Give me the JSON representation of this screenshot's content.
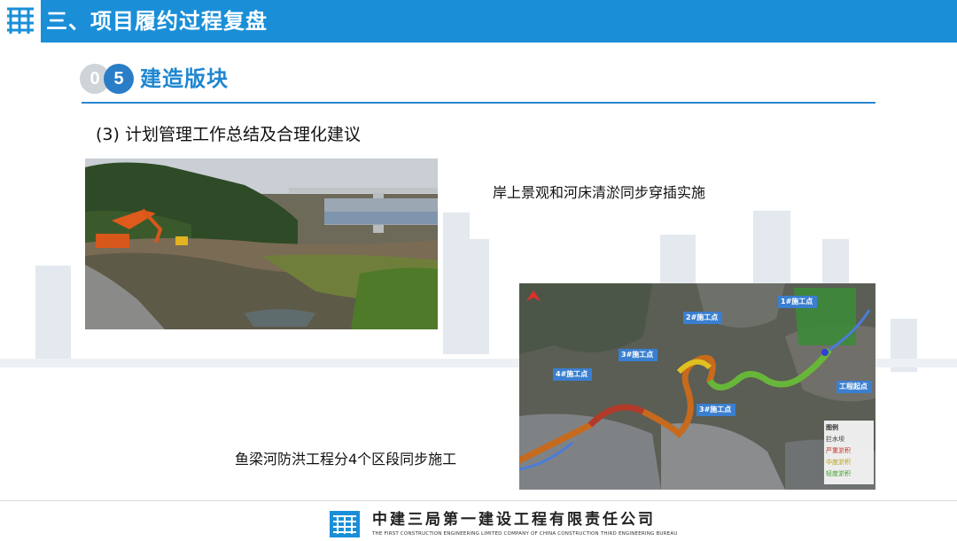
{
  "header": {
    "logo": "cscec-logo-icon",
    "title": "三、项目履约过程复盘",
    "color": "#1a8fd8"
  },
  "section": {
    "number_first": "0",
    "number_second": "5",
    "title": "建造版块",
    "accent": "#1f86d1"
  },
  "subtitle": "(3) 计划管理工作总结及合理化建议",
  "captions": {
    "photo": "岸上景观和河床清淤同步穿插实施",
    "map": "鱼梁河防洪工程分4个区段同步施工"
  },
  "map_labels": {
    "site1": "1#施工点",
    "site2": "2#施工点",
    "site3a": "3#施工点",
    "site3b": "3#施工点",
    "site4": "4#施工点",
    "start": "工程起点",
    "legend": [
      "图例",
      "拦水坝",
      "严重淤积",
      "中度淤积",
      "轻度淤积"
    ]
  },
  "footer": {
    "logo": "cscec-logo-icon",
    "company_cn": "中建三局第一建设工程有限责任公司",
    "company_en": "THE FIRST CONSTRUCTION ENGINEERING LIMITED COMPANY OF CHINA CONSTRUCTION THIRD ENGINEERING BUREAU"
  }
}
